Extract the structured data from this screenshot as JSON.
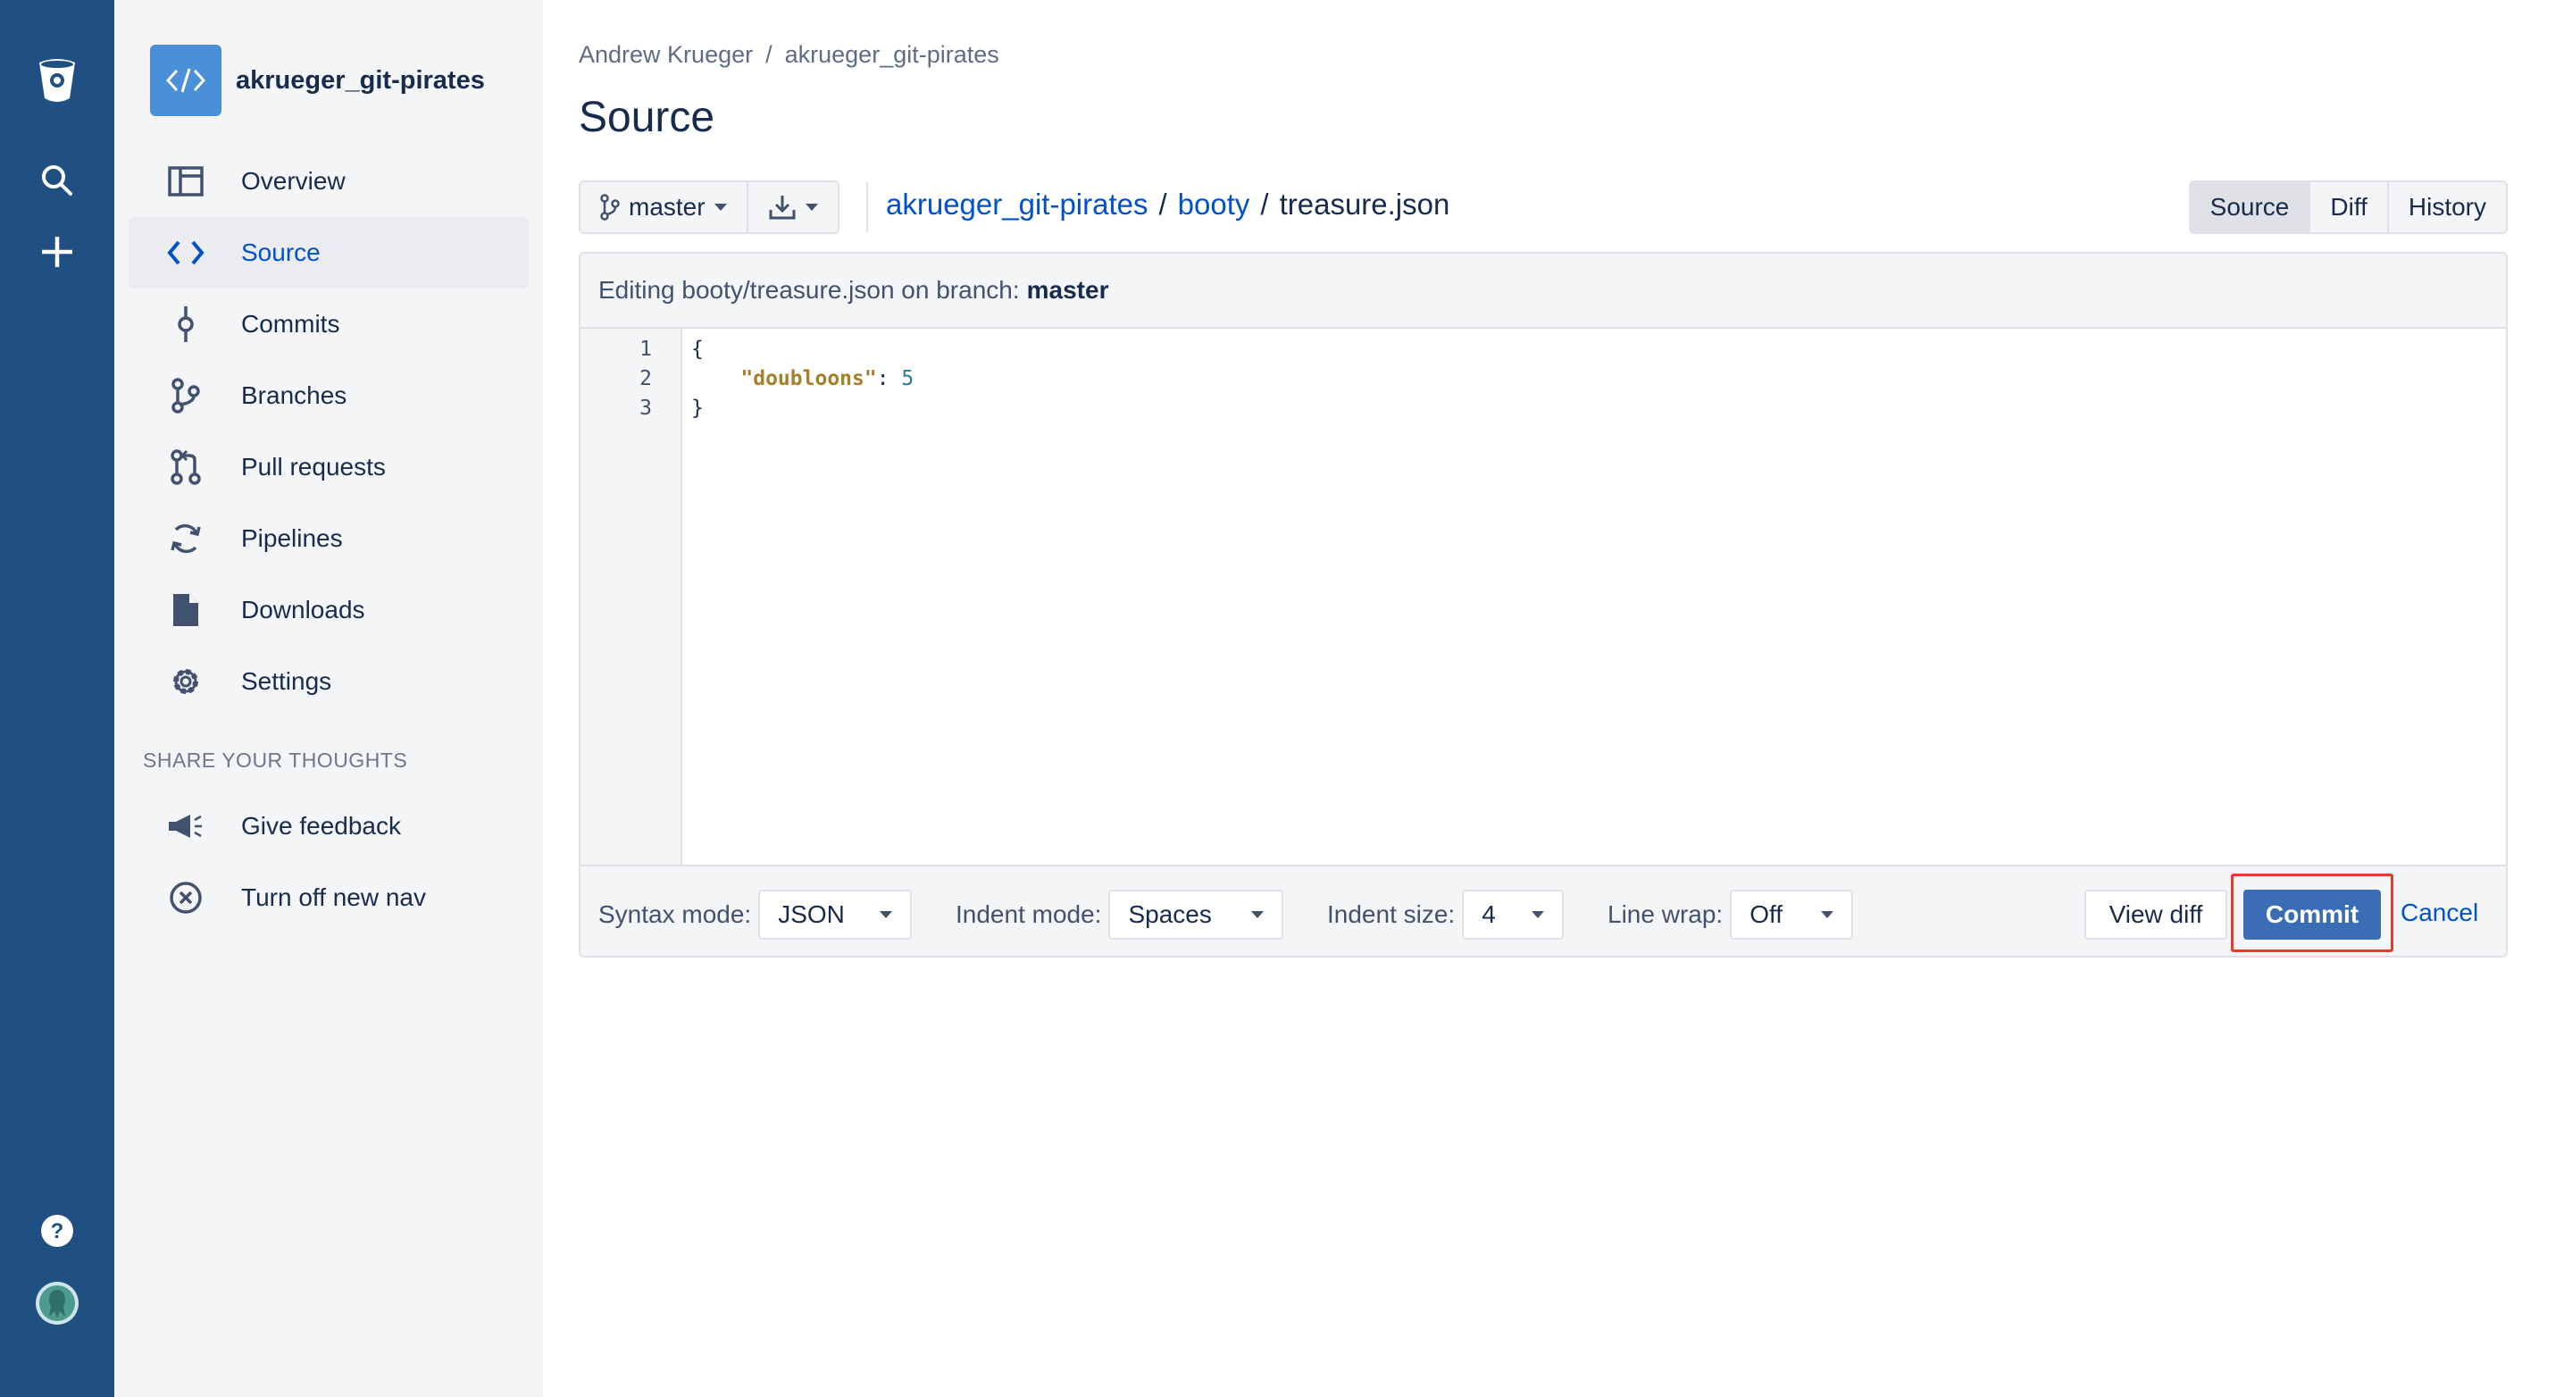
{
  "colors": {
    "rail": "#205081",
    "accent": "#0052cc",
    "commit": "#3a6db5",
    "highlight": "#e53a2e"
  },
  "rail": {
    "icons": [
      "bitbucket-logo-icon",
      "search-icon",
      "create-plus-icon",
      "help-icon",
      "user-avatar-icon"
    ]
  },
  "project": {
    "name": "akrueger_git-pirates"
  },
  "sidebar": {
    "items": [
      {
        "label": "Overview",
        "icon": "overview-icon"
      },
      {
        "label": "Source",
        "icon": "code-icon",
        "active": true
      },
      {
        "label": "Commits",
        "icon": "commit-icon"
      },
      {
        "label": "Branches",
        "icon": "branch-icon"
      },
      {
        "label": "Pull requests",
        "icon": "pull-request-icon"
      },
      {
        "label": "Pipelines",
        "icon": "pipelines-icon"
      },
      {
        "label": "Downloads",
        "icon": "file-icon"
      },
      {
        "label": "Settings",
        "icon": "gear-icon"
      }
    ],
    "section_title": "SHARE YOUR THOUGHTS",
    "extra": [
      {
        "label": "Give feedback",
        "icon": "megaphone-icon"
      },
      {
        "label": "Turn off new nav",
        "icon": "close-circle-icon"
      }
    ]
  },
  "breadcrumb": {
    "owner": "Andrew Krueger",
    "sep": "/",
    "repo": "akrueger_git-pirates"
  },
  "page": {
    "title": "Source"
  },
  "toolbar": {
    "branch": "master",
    "path": {
      "repo": "akrueger_git-pirates",
      "folder": "booty",
      "sep": "/",
      "file": "treasure.json"
    },
    "tabs": [
      "Source",
      "Diff",
      "History"
    ]
  },
  "editor": {
    "header_prefix": "Editing booty/treasure.json on branch:",
    "header_branch": "master",
    "lines": [
      {
        "num": "1",
        "text": "{"
      },
      {
        "num": "2",
        "key": "\"doubloons\"",
        "colon": ": ",
        "value": "5"
      },
      {
        "num": "3",
        "text": "}"
      }
    ],
    "footer": {
      "syntax_label": "Syntax mode:",
      "syntax_value": "JSON",
      "indent_mode_label": "Indent mode:",
      "indent_mode_value": "Spaces",
      "indent_size_label": "Indent size:",
      "indent_size_value": "4",
      "line_wrap_label": "Line wrap:",
      "line_wrap_value": "Off",
      "view_diff": "View diff",
      "commit": "Commit",
      "cancel": "Cancel"
    }
  }
}
